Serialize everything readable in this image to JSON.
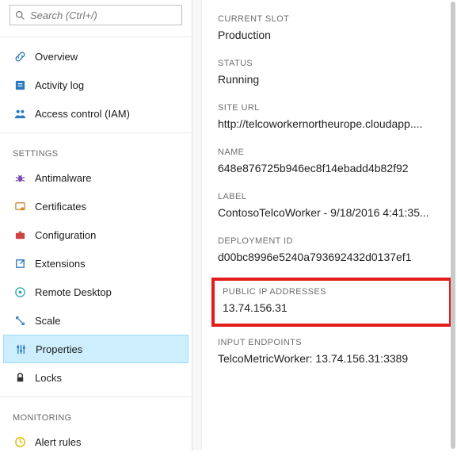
{
  "search": {
    "placeholder": "Search (Ctrl+/)"
  },
  "nav": {
    "top": [
      {
        "label": "Overview",
        "icon": "link-icon",
        "color": "c-blue"
      },
      {
        "label": "Activity log",
        "icon": "log-icon",
        "color": "c-blue"
      },
      {
        "label": "Access control (IAM)",
        "icon": "people-icon",
        "color": "c-blue"
      }
    ],
    "settings_label": "SETTINGS",
    "settings": [
      {
        "label": "Antimalware",
        "icon": "bug-icon",
        "color": "c-purple"
      },
      {
        "label": "Certificates",
        "icon": "certificate-icon",
        "color": "c-orange"
      },
      {
        "label": "Configuration",
        "icon": "briefcase-icon",
        "color": "c-red"
      },
      {
        "label": "Extensions",
        "icon": "extension-icon",
        "color": "c-blue"
      },
      {
        "label": "Remote Desktop",
        "icon": "remote-icon",
        "color": "c-teal"
      },
      {
        "label": "Scale",
        "icon": "scale-icon",
        "color": "c-blue"
      },
      {
        "label": "Properties",
        "icon": "properties-icon",
        "color": "c-blue",
        "selected": true
      },
      {
        "label": "Locks",
        "icon": "lock-icon",
        "color": "c-dark"
      }
    ],
    "monitoring_label": "MONITORING",
    "monitoring": [
      {
        "label": "Alert rules",
        "icon": "alert-icon",
        "color": "c-yellow"
      }
    ]
  },
  "details": {
    "current_slot": {
      "label": "CURRENT SLOT",
      "value": "Production"
    },
    "status": {
      "label": "STATUS",
      "value": "Running"
    },
    "site_url": {
      "label": "SITE URL",
      "value": "http://telcoworkernortheurope.cloudapp...."
    },
    "name": {
      "label": "NAME",
      "value": "648e876725b946ec8f14ebadd4b82f92"
    },
    "labelf": {
      "label": "LABEL",
      "value": "ContosoTelcoWorker - 9/18/2016 4:41:35..."
    },
    "deployment_id": {
      "label": "DEPLOYMENT ID",
      "value": "d00bc8996e5240a793692432d0137ef1"
    },
    "public_ip": {
      "label": "PUBLIC IP ADDRESSES",
      "value": "13.74.156.31"
    },
    "input_endpoints": {
      "label": "INPUT ENDPOINTS",
      "value": "TelcoMetricWorker: 13.74.156.31:3389"
    }
  }
}
